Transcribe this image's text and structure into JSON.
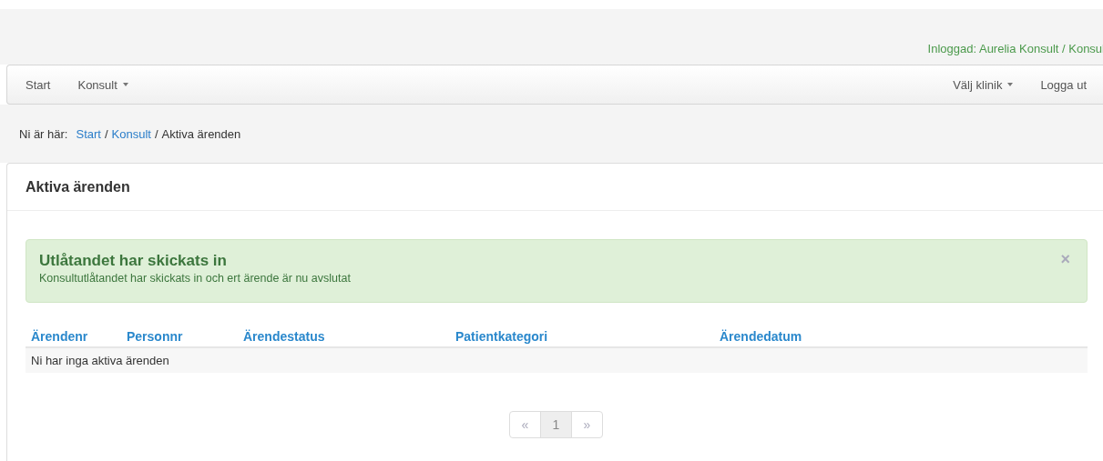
{
  "header": {
    "login_text": "Inloggad: Aurelia Konsult / Konsul"
  },
  "navbar": {
    "left": [
      {
        "label": "Start",
        "dropdown": false
      },
      {
        "label": "Konsult",
        "dropdown": true
      }
    ],
    "right": [
      {
        "label": "Välj klinik",
        "dropdown": true
      },
      {
        "label": "Logga ut",
        "dropdown": false
      }
    ]
  },
  "breadcrumb": {
    "prefix": "Ni är här:",
    "links": [
      "Start",
      "Konsult"
    ],
    "current": "Aktiva ärenden",
    "separator": "/"
  },
  "panel": {
    "title": "Aktiva ärenden"
  },
  "alert": {
    "title": "Utlåtandet har skickats in",
    "message": "Konsultutlåtandet har skickats in och ert ärende är nu avslutat",
    "close": "×"
  },
  "table": {
    "columns": [
      "Ärendenr",
      "Personnr",
      "Ärendestatus",
      "Patientkategori",
      "Ärendedatum"
    ],
    "empty_text": "Ni har inga aktiva ärenden"
  },
  "pagination": [
    {
      "label": "«",
      "selected": false,
      "disabled": true
    },
    {
      "label": "1",
      "selected": true,
      "disabled": false
    },
    {
      "label": "»",
      "selected": false,
      "disabled": true
    }
  ]
}
